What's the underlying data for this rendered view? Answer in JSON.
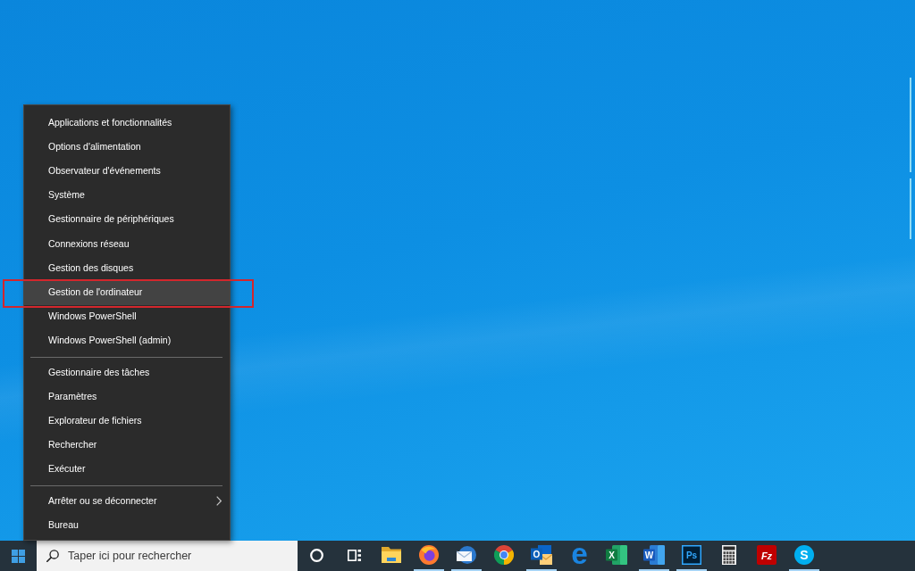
{
  "context_menu": {
    "groups": [
      {
        "items": [
          {
            "label": "Applications et fonctionnalités",
            "hovered": false,
            "annotated": false,
            "submenu": false
          },
          {
            "label": "Options d'alimentation",
            "hovered": false,
            "annotated": false,
            "submenu": false
          },
          {
            "label": "Observateur d'événements",
            "hovered": false,
            "annotated": false,
            "submenu": false
          },
          {
            "label": "Système",
            "hovered": false,
            "annotated": false,
            "submenu": false
          },
          {
            "label": "Gestionnaire de périphériques",
            "hovered": false,
            "annotated": false,
            "submenu": false
          },
          {
            "label": "Connexions réseau",
            "hovered": false,
            "annotated": false,
            "submenu": false
          },
          {
            "label": "Gestion des disques",
            "hovered": false,
            "annotated": false,
            "submenu": false
          },
          {
            "label": "Gestion de l'ordinateur",
            "hovered": true,
            "annotated": true,
            "submenu": false
          },
          {
            "label": "Windows PowerShell",
            "hovered": false,
            "annotated": false,
            "submenu": false
          },
          {
            "label": "Windows PowerShell (admin)",
            "hovered": false,
            "annotated": false,
            "submenu": false
          }
        ]
      },
      {
        "items": [
          {
            "label": "Gestionnaire des tâches",
            "hovered": false,
            "annotated": false,
            "submenu": false
          },
          {
            "label": "Paramètres",
            "hovered": false,
            "annotated": false,
            "submenu": false
          },
          {
            "label": "Explorateur de fichiers",
            "hovered": false,
            "annotated": false,
            "submenu": false
          },
          {
            "label": "Rechercher",
            "hovered": false,
            "annotated": false,
            "submenu": false
          },
          {
            "label": "Exécuter",
            "hovered": false,
            "annotated": false,
            "submenu": false
          }
        ]
      },
      {
        "items": [
          {
            "label": "Arrêter ou se déconnecter",
            "hovered": false,
            "annotated": false,
            "submenu": true
          },
          {
            "label": "Bureau",
            "hovered": false,
            "annotated": false,
            "submenu": false
          }
        ]
      }
    ]
  },
  "taskbar": {
    "search": {
      "placeholder": "Taper ici pour rechercher"
    },
    "buttons": [
      {
        "kind": "cortana",
        "running": false
      },
      {
        "kind": "task-view",
        "running": false
      },
      {
        "kind": "explorer",
        "running": false
      },
      {
        "kind": "firefox",
        "running": true
      },
      {
        "kind": "mail",
        "running": true
      },
      {
        "kind": "chrome",
        "running": false
      },
      {
        "kind": "outlook",
        "glyph": "O",
        "running": true
      },
      {
        "kind": "edge",
        "glyph": "e",
        "running": false
      },
      {
        "kind": "excel",
        "glyph": "X",
        "running": false
      },
      {
        "kind": "word",
        "glyph": "W",
        "running": true
      },
      {
        "kind": "photoshop",
        "glyph": "Ps",
        "running": true
      },
      {
        "kind": "calculator",
        "running": false
      },
      {
        "kind": "filezilla",
        "glyph": "Fz",
        "running": false
      },
      {
        "kind": "skype",
        "glyph": "S",
        "running": true
      }
    ]
  }
}
